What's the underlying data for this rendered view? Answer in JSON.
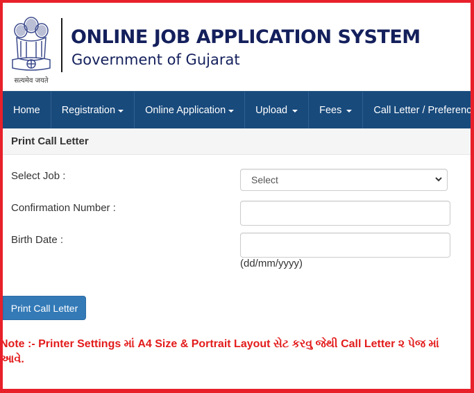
{
  "header": {
    "emblem_motto": "सत्यमेव जयते",
    "title": "ONLINE JOB APPLICATION SYSTEM",
    "subtitle": "Government of Gujarat"
  },
  "nav": {
    "items": [
      {
        "label": "Home",
        "dropdown": false
      },
      {
        "label": "Registration",
        "dropdown": true
      },
      {
        "label": "Online Application",
        "dropdown": true
      },
      {
        "label": "Upload",
        "dropdown": true
      },
      {
        "label": "Fees",
        "dropdown": true
      },
      {
        "label": "Call Letter / Preference",
        "dropdown": false
      }
    ]
  },
  "panel": {
    "heading": "Print Call Letter"
  },
  "form": {
    "select_job": {
      "label": "Select Job :",
      "value": "Select"
    },
    "confirmation_number": {
      "label": "Confirmation Number :",
      "value": ""
    },
    "birth_date": {
      "label": "Birth Date :",
      "value": "",
      "hint": "(dd/mm/yyyy)"
    },
    "submit_label": "Print Call Letter"
  },
  "note": "Note :- Printer Settings માં A4 Size & Portrait Layout સેટ કરવુ જેથી Call Letter ૨ પેજ માં આવે.",
  "colors": {
    "frame_border": "#e8202a",
    "navbar": "#184a7c",
    "title_text": "#14205c",
    "button": "#337ab7",
    "note_text": "#e31b1b"
  }
}
